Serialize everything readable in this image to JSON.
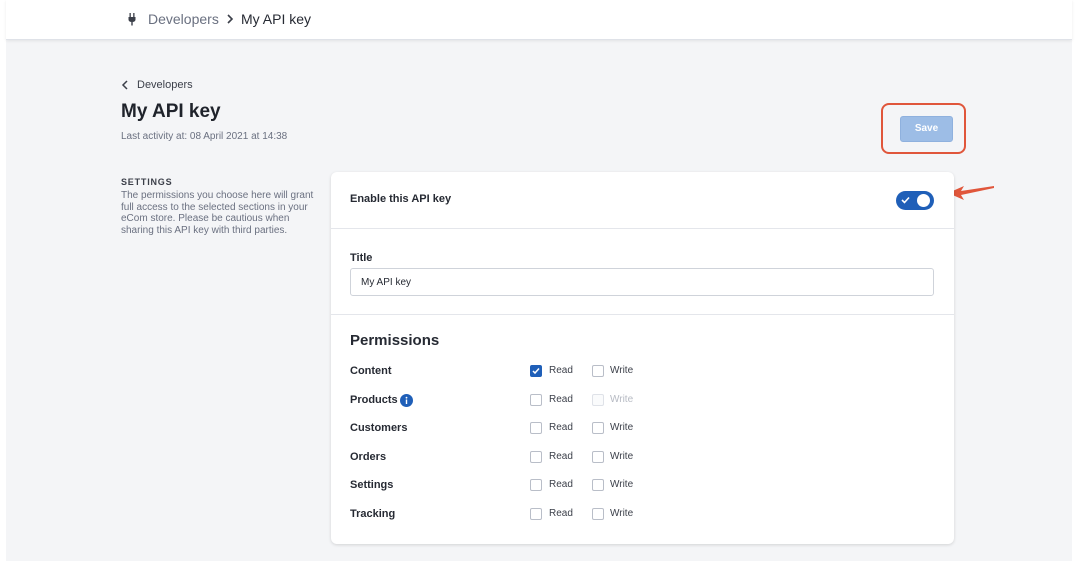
{
  "breadcrumb": {
    "parent": "Developers",
    "current": "My API key"
  },
  "back_link": "Developers",
  "page_title": "My API key",
  "last_activity": "Last activity at: 08 April 2021 at 14:38",
  "save_label": "Save",
  "settings": {
    "heading": "SETTINGS",
    "description": "The permissions you choose here will grant full access to the selected sections in your eCom store. Please be cautious when sharing this API key with third parties."
  },
  "enable": {
    "label": "Enable this API key",
    "enabled": true
  },
  "title_field": {
    "label": "Title",
    "value": "My API key"
  },
  "permissions": {
    "heading": "Permissions",
    "read_label": "Read",
    "write_label": "Write",
    "rows": [
      {
        "name": "Content",
        "read": true,
        "write": false,
        "write_disabled": false,
        "info": false
      },
      {
        "name": "Products",
        "read": false,
        "write": false,
        "write_disabled": true,
        "info": true
      },
      {
        "name": "Customers",
        "read": false,
        "write": false,
        "write_disabled": false,
        "info": false
      },
      {
        "name": "Orders",
        "read": false,
        "write": false,
        "write_disabled": false,
        "info": false
      },
      {
        "name": "Settings",
        "read": false,
        "write": false,
        "write_disabled": false,
        "info": false
      },
      {
        "name": "Tracking",
        "read": false,
        "write": false,
        "write_disabled": false,
        "info": false
      }
    ]
  },
  "colors": {
    "accent": "#1f5fb8",
    "save_button": "#9dbde6",
    "highlight": "#e0563b",
    "background": "#f4f5f7"
  },
  "icons": {
    "breadcrumb": "plug-icon",
    "separator": "chevron-right-icon",
    "back": "chevron-left-icon",
    "info": "info-icon",
    "annotation": "arrow-icon"
  }
}
